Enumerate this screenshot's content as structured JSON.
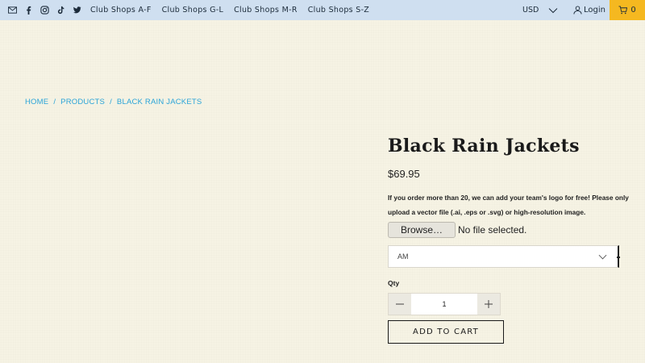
{
  "topbar": {
    "background": "#cfdff0",
    "social_icons": [
      "mail-icon",
      "facebook-icon",
      "instagram-icon",
      "tiktok-icon",
      "twitter-icon"
    ],
    "shops": [
      {
        "label": "Club Shops A-F"
      },
      {
        "label": "Club Shops G-L"
      },
      {
        "label": "Club Shops M-R"
      },
      {
        "label": "Club Shops S-Z"
      }
    ],
    "currency": "USD",
    "login_label": "Login",
    "cart_count": "0",
    "cart_color": "#f5b820"
  },
  "breadcrumb": {
    "items": [
      "HOME",
      "PRODUCTS",
      "BLACK RAIN JACKETS"
    ],
    "separator": "/",
    "color": "#2aa4d8"
  },
  "product": {
    "title": "Black Rain Jackets",
    "price": "$69.95",
    "note": "If you order more than 20, we can add your team's logo for free! Please only upload a vector file (.ai, .eps or .svg) or high-resolution image.",
    "browse_label": "Browse…",
    "file_status": "No file selected.",
    "select_value": "AM",
    "qty_label": "Qty",
    "qty_value": "1",
    "add_to_cart_label": "ADD TO CART"
  }
}
